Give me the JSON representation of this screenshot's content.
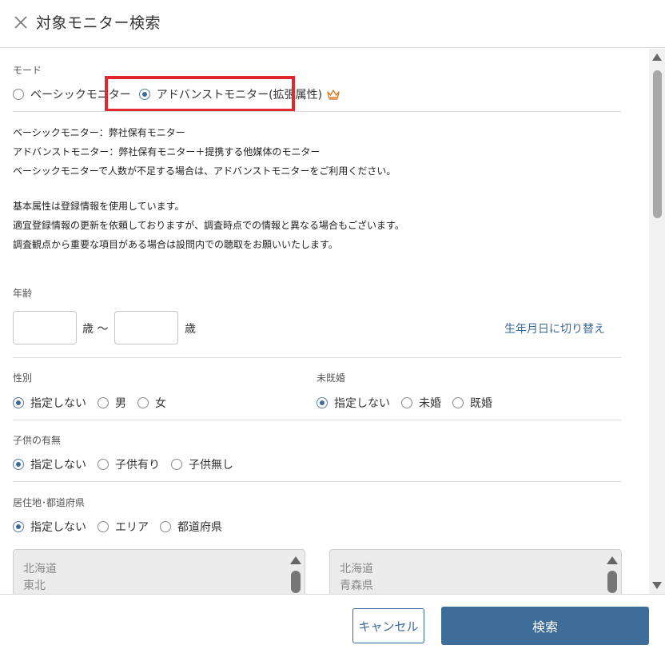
{
  "header": {
    "title": "対象モニター検索"
  },
  "mode": {
    "label": "モード",
    "options": [
      "ベーシックモニター",
      "アドバンストモニター(拡張属性)"
    ],
    "selected_index": 1
  },
  "description": {
    "lines": [
      "ベーシックモニター：弊社保有モニター",
      "アドバンストモニター：弊社保有モニター＋提携する他媒体のモニター",
      "ベーシックモニターで人数が不足する場合は、アドバンストモニターをご利用ください。",
      "基本属性は登録情報を使用しています。",
      "適宜登録情報の更新を依頼しておりますが、調査時点での情報と異なる場合もございます。",
      "調査観点から重要な項目がある場合は設問内での聴取をお願いいたします。"
    ]
  },
  "age": {
    "label": "年齢",
    "min_value": "",
    "max_value": "",
    "unit_from": "歳 〜",
    "unit_to": "歳",
    "switch_link": "生年月日に切り替え"
  },
  "gender": {
    "label": "性別",
    "options": [
      "指定しない",
      "男",
      "女"
    ],
    "selected_index": 0
  },
  "marital": {
    "label": "未既婚",
    "options": [
      "指定しない",
      "未婚",
      "既婚"
    ],
    "selected_index": 0
  },
  "children": {
    "label": "子供の有無",
    "options": [
      "指定しない",
      "子供有り",
      "子供無し"
    ],
    "selected_index": 0
  },
  "residence": {
    "label": "居住地･都道府県",
    "options": [
      "指定しない",
      "エリア",
      "都道府県"
    ],
    "selected_index": 0,
    "area_list": [
      "北海道",
      "東北"
    ],
    "prefecture_list": [
      "北海道",
      "青森県"
    ]
  },
  "footer": {
    "cancel_label": "キャンセル",
    "search_label": "検索"
  },
  "colors": {
    "accent": "#3e6d99",
    "highlight": "#e0282e",
    "crown": "#e07a1f"
  },
  "icons": {
    "close": "close-icon",
    "crown": "crown-icon"
  }
}
